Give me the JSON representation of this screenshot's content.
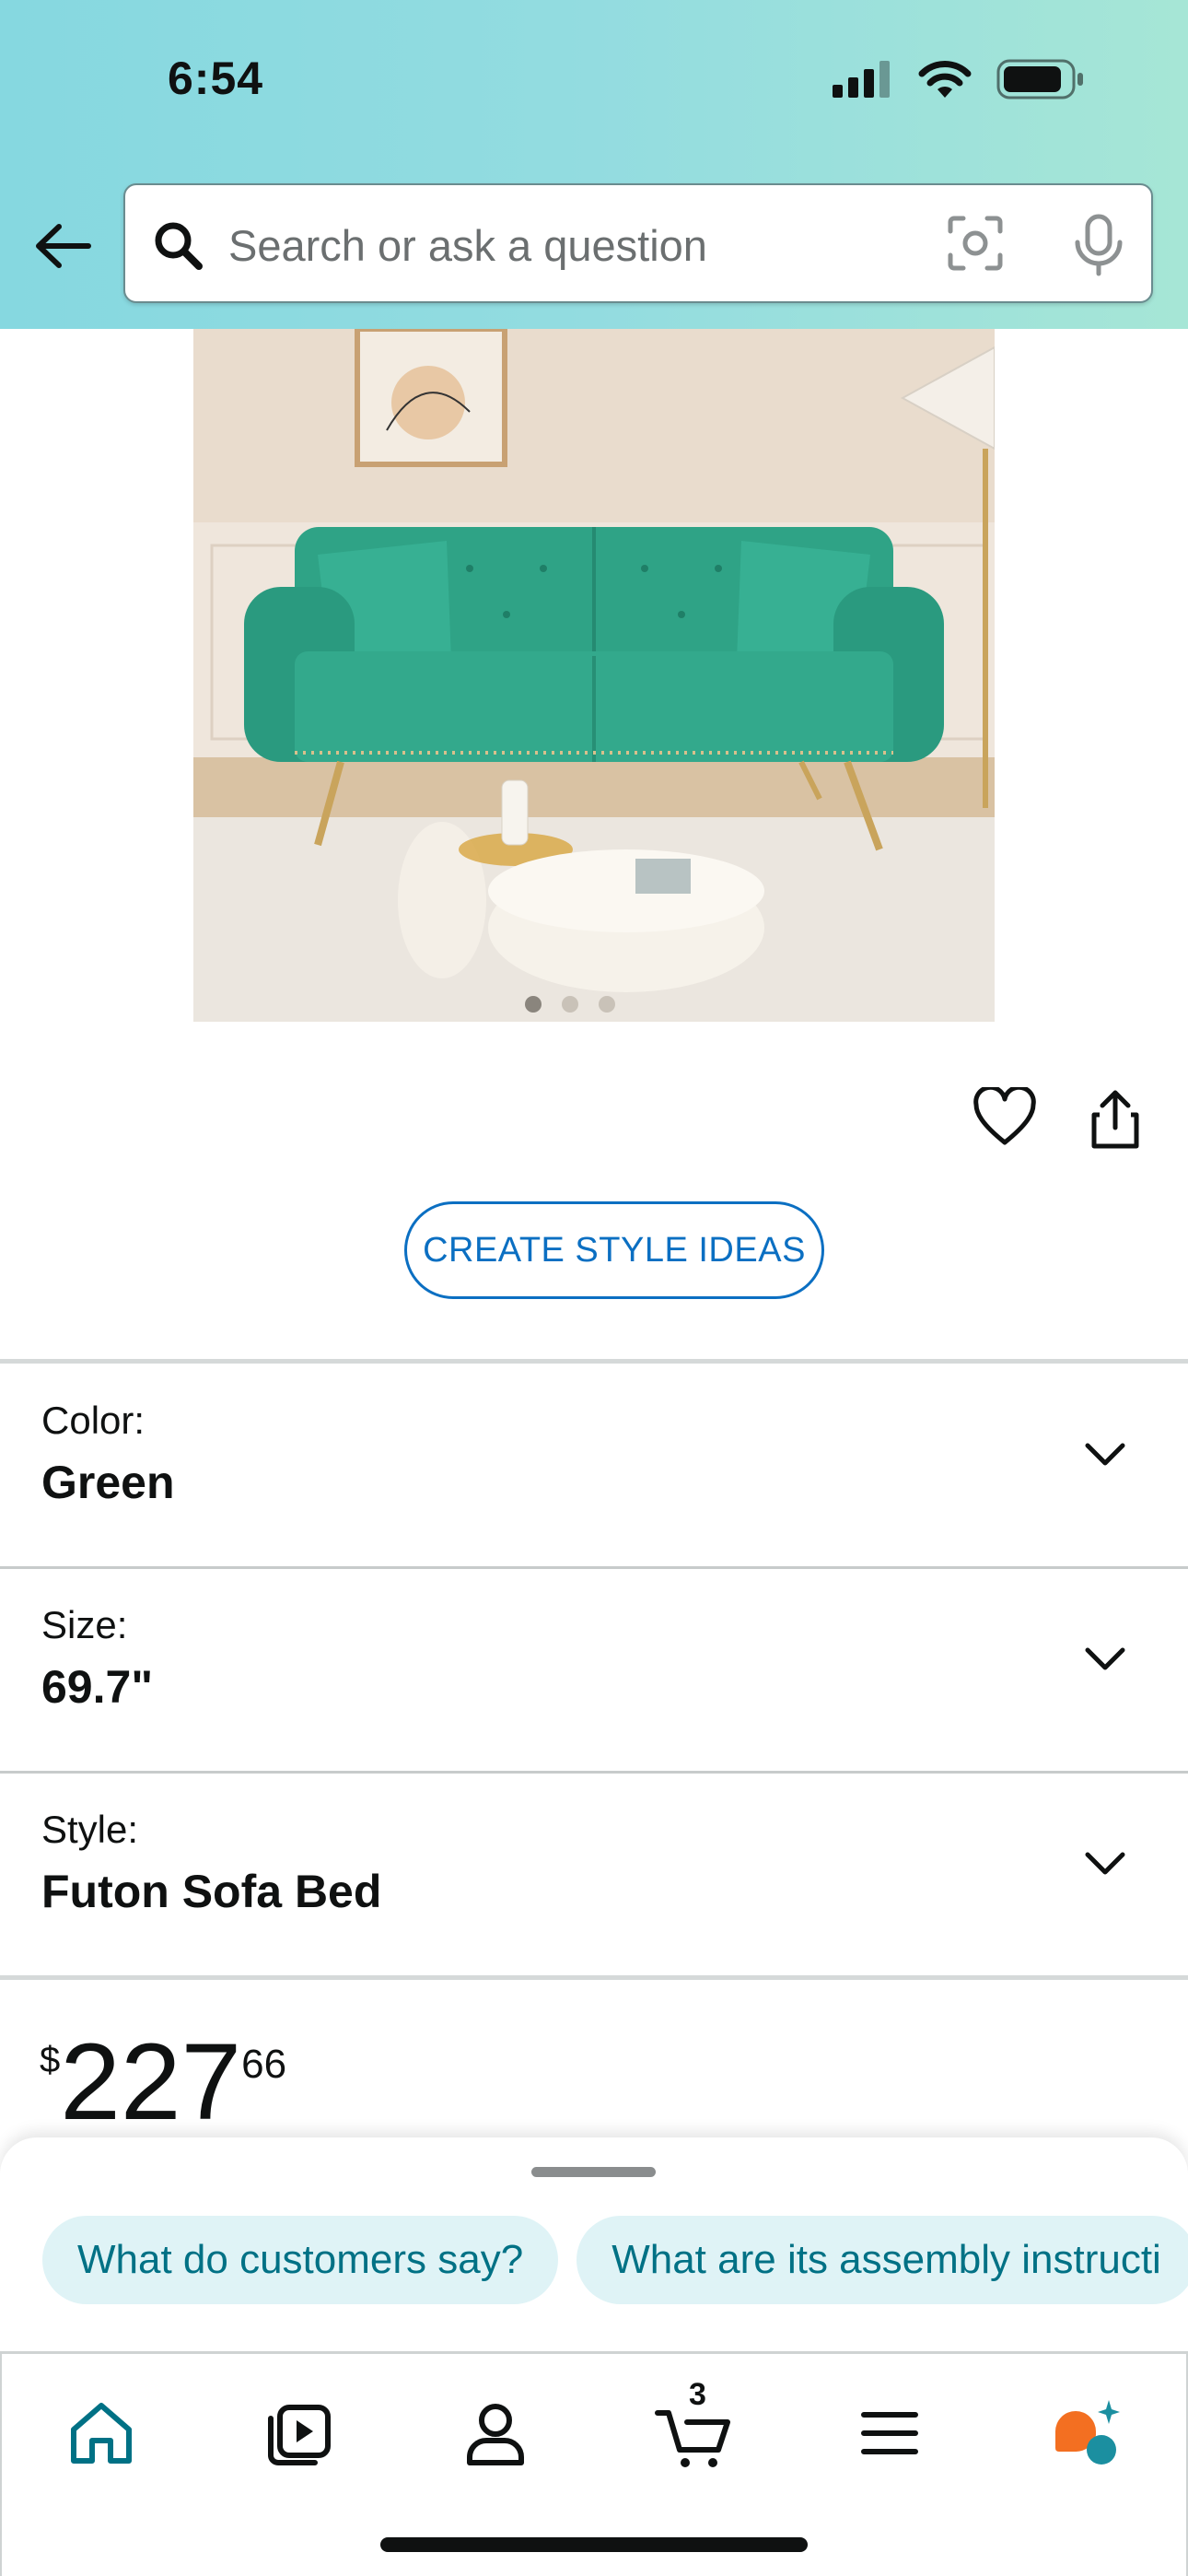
{
  "status_bar": {
    "time": "6:54"
  },
  "search": {
    "placeholder": "Search or ask a question"
  },
  "product": {
    "image_alt": "Green tufted velvet futon sofa",
    "carousel_total": 3,
    "carousel_active": 1,
    "create_style_label": "CREATE STYLE IDEAS",
    "options": [
      {
        "label": "Color:",
        "value": "Green"
      },
      {
        "label": "Size:",
        "value": "69.7\""
      },
      {
        "label": "Style:",
        "value": "Futon Sofa Bed"
      }
    ],
    "price": {
      "symbol": "$",
      "whole": "227",
      "fraction": "66"
    }
  },
  "questions": [
    "What do customers say?",
    "What are its assembly instructi"
  ],
  "tabbar": {
    "items": [
      "home-icon",
      "video-icon",
      "account-icon",
      "cart-icon",
      "menu-icon",
      "rufus-icon"
    ],
    "cart_count": "3"
  },
  "colors": {
    "accent_teal": "#007185",
    "link_blue": "#0b6fc2",
    "rufus_orange": "#f36f21",
    "header_teal": "#93dce0"
  }
}
